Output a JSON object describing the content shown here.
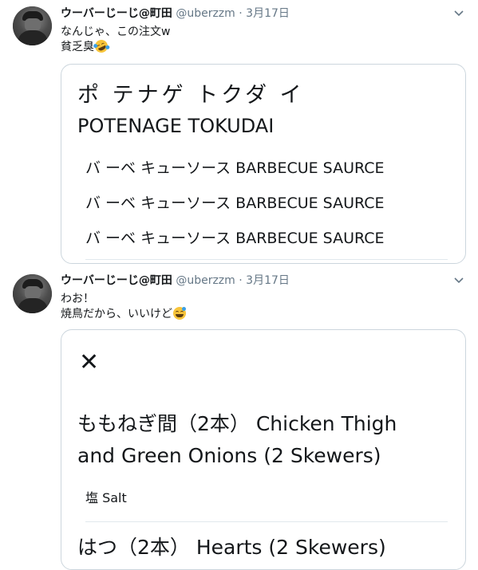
{
  "tweets": [
    {
      "name": "ウーバーじーじ@町田",
      "handle": "@uberzzm",
      "separator": "·",
      "date": "3月17日",
      "text_line1": "なんじゃ、この注文w",
      "text_line2": "貧乏臭",
      "emoji": "rolling-on-floor-laughing-emoji",
      "card": {
        "title": "ポ テナゲ トクダ イ",
        "title_romaji": "POTENAGE TOKUDAI",
        "items": [
          "バ ーベ キューソース BARBECUE SAURCE",
          "バ ーベ キューソース BARBECUE SAURCE",
          "バ ーベ キューソース BARBECUE SAURCE"
        ]
      }
    },
    {
      "name": "ウーバーじーじ@町田",
      "handle": "@uberzzm",
      "separator": "·",
      "date": "3月17日",
      "text_line1": "わお！",
      "text_line2": "焼鳥だから、いいけど",
      "emoji": "grinning-sweat-emoji",
      "card": {
        "close_symbol": "✕",
        "line1": "ももねぎ間（2本） Chicken Thigh",
        "line2": "and Green Onions (2 Skewers)",
        "option": "塩 Salt",
        "line3": "はつ（2本） Hearts (2 Skewers)"
      }
    }
  ],
  "colors": {
    "secondary_text": "#657786",
    "border": "#ccd6dd",
    "emoji": "#f7c43a"
  }
}
